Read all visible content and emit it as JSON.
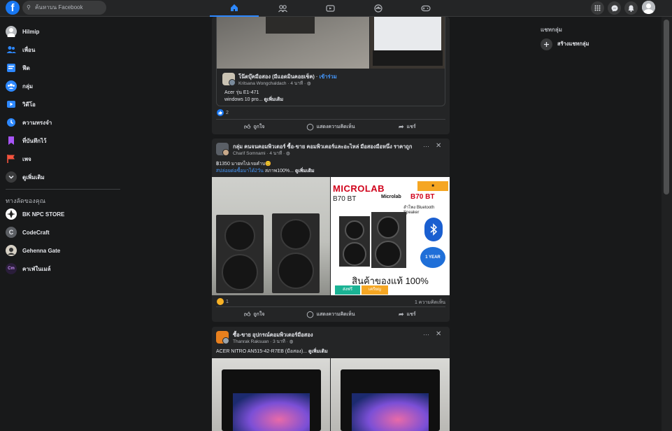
{
  "topbar": {
    "logo": "f",
    "search_placeholder": "ค้นหาบน Facebook",
    "nav_icons": [
      "home-icon",
      "friends-icon",
      "watch-icon",
      "groups-icon",
      "gaming-icon"
    ],
    "right_icons": [
      "menu-grid-icon",
      "messenger-icon",
      "notifications-icon"
    ]
  },
  "sidebar": {
    "items": [
      {
        "label": "Hilmip",
        "icon": "avatar",
        "color": "#d8dadf"
      },
      {
        "label": "เพื่อน",
        "icon": "friends-icon",
        "color": "#2d88ff"
      },
      {
        "label": "ฟีด",
        "icon": "feed-icon",
        "color": "#2d88ff"
      },
      {
        "label": "กลุ่ม",
        "icon": "groups-icon",
        "color": "#2d88ff"
      },
      {
        "label": "วิดีโอ",
        "icon": "video-icon",
        "color": "#2d88ff"
      },
      {
        "label": "ความทรงจำ",
        "icon": "memories-icon",
        "color": "#2d88ff"
      },
      {
        "label": "ที่บันทึกไว้",
        "icon": "saved-icon",
        "color": "#a855f7"
      },
      {
        "label": "เพจ",
        "icon": "pages-icon",
        "color": "#f5533d"
      },
      {
        "label": "ดูเพิ่มเติม",
        "icon": "chevron-down-icon",
        "color": "#3a3b3c"
      }
    ],
    "shortcuts_title": "ทางลัดของคุณ",
    "shortcuts": [
      {
        "label": "BK NPC STORE"
      },
      {
        "label": "CodeCraft"
      },
      {
        "label": "Gehenna Gate"
      },
      {
        "label": "คาเฟ่ในเมล์"
      }
    ]
  },
  "right": {
    "group_chats_title": "แชทกลุ่ม",
    "create_group_chat": "สร้างแชทกลุ่ม"
  },
  "post1": {
    "group": "โน๊ตบุ๊คมือสอง (มีแอดมินคอยเช็ค)",
    "join": "เข้าร่วม",
    "author": "Kritsana Wongchaldach",
    "time": "4 นาที",
    "text1": "Acer รุ่น E1-471",
    "text2": "windows 10 pro...",
    "see_more": "ดูเพิ่มเติม",
    "reactions": "2",
    "actions": {
      "like": "ถูกใจ",
      "comment": "แสดงความคิดเห็น",
      "share": "แชร์"
    }
  },
  "post2": {
    "group": "กลุ่ม คนจนคอมพิวเตอร์ ซื้อ-ขาย คอมพิวเตอร์และอะไหล่ มือสองมือหนึ่ง ราคาถูก",
    "author": "Charif Somnami",
    "time": "4 นาที",
    "text1": "฿1350 มายทไปเรยคำบ😊",
    "hashtag": "#ปล่อยต่อซื้อมาได้2วัน",
    "text2": "สภาพ100%...",
    "see_more": "ดูเพิ่มเติม",
    "ad_brand": "MICROLAB",
    "ad_model": "B70 BT",
    "ad_brand2": "Microlab",
    "ad_model2": "B70 BT",
    "ad_sub": "ลำโพง Bluetooth Speaker",
    "ad_warranty": "1 YEAR",
    "ad_genuine": "สินค้าของแท้ 100%",
    "ad_badge1": "ส่งฟรี",
    "ad_badge2": "เครียญ",
    "reactions": "1",
    "comments": "1 ความคิดเห็น",
    "actions": {
      "like": "ถูกใจ",
      "comment": "แสดงความคิดเห็น",
      "share": "แชร์"
    }
  },
  "post3": {
    "group": "ซื้อ-ขาย อุปกรณ์คอมพิวเตอร์มือสอง",
    "author": "Thanrak Raksuan",
    "time": "3 นาที",
    "text1": "ACER NITRO AN515-42-R7EB (มือสอง)...",
    "see_more": "ดูเพิ่มเติม"
  }
}
